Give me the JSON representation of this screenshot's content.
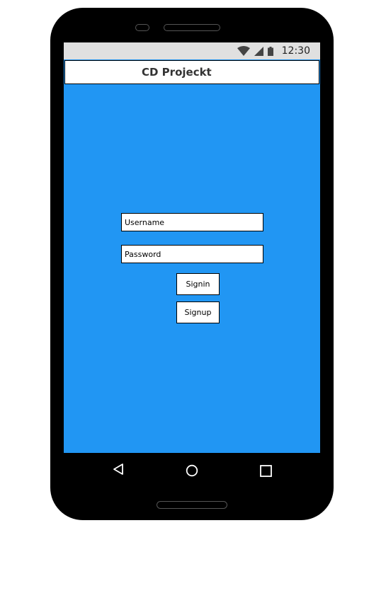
{
  "status_bar": {
    "time": "12:30",
    "icons": [
      "wifi-icon",
      "signal-icon",
      "battery-icon"
    ]
  },
  "app_bar": {
    "title": "CD Projeckt"
  },
  "login_form": {
    "username_placeholder": "Username",
    "password_placeholder": "Password",
    "signin_label": "Signin",
    "signup_label": "Signup"
  },
  "nav_bar": {
    "icons": [
      "back-icon",
      "home-icon",
      "recent-apps-icon"
    ]
  },
  "colors": {
    "screen_background": "#2196f3",
    "status_bar_background": "#e0e0e0",
    "device_frame": "#000000"
  }
}
